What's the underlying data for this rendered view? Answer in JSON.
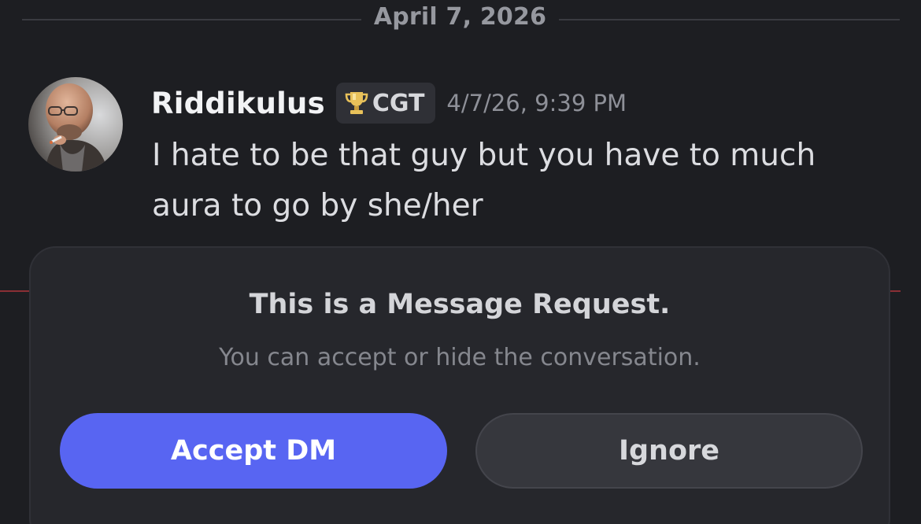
{
  "divider": {
    "date": "April 7, 2026"
  },
  "message": {
    "username": "Riddikulus",
    "tag": {
      "icon": "trophy-icon",
      "text": "CGT"
    },
    "timestamp": "4/7/26, 9:39 PM",
    "text": "I hate to be that guy but you have to much aura to go by she/her"
  },
  "request": {
    "title": "This is a Message Request.",
    "subtitle": "You can accept or hide the conversation.",
    "accept_label": "Accept DM",
    "ignore_label": "Ignore"
  },
  "colors": {
    "background": "#1d1e22",
    "card": "#26272c",
    "accent": "#5865f2",
    "secondary_button": "#36373d"
  }
}
